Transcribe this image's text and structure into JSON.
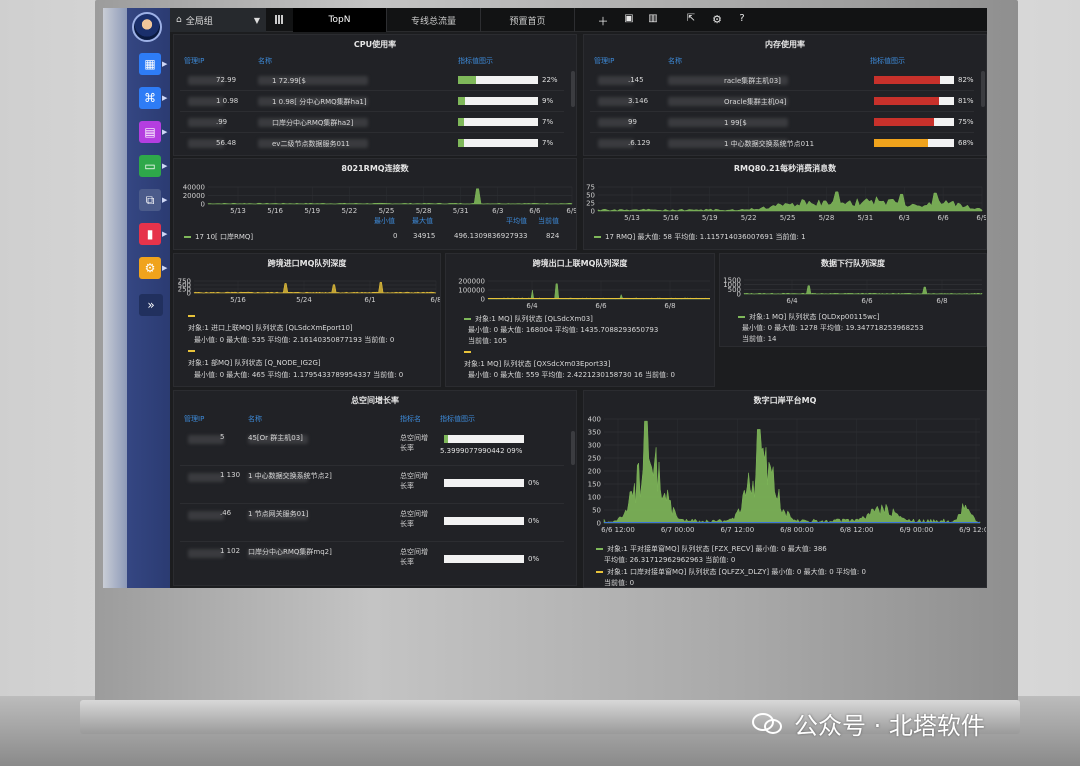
{
  "topbar": {
    "group_select": "全局组",
    "tabs": [
      "TopN",
      "专线总流量",
      "预置首页"
    ],
    "active_tab": 0,
    "icons": [
      "plus-icon",
      "save-icon",
      "trash-icon",
      "external-link-icon",
      "gear-icon",
      "help-icon"
    ]
  },
  "sidebar": {
    "items": [
      "dashboard-icon",
      "topology-icon",
      "app-icon",
      "monitor-icon",
      "devices-icon",
      "report-icon",
      "settings-icon"
    ],
    "colors": [
      "#2e7cf6",
      "#2e7cf6",
      "#b43ee0",
      "#2ea84a",
      "#4b5b8a",
      "#e6334b",
      "#f0a31c"
    ],
    "expand": "»"
  },
  "cpu": {
    "title": "CPU使用率",
    "headers": [
      "管理IP",
      "名称",
      "指标值图示"
    ],
    "rows": [
      {
        "ip": "72.99",
        "name": "1 72.99[$",
        "pct": "22%",
        "value": 22
      },
      {
        "ip": "1 0.98",
        "name": "1 0.98[ 分中心RMQ集群ha1]",
        "pct": "9%",
        "value": 9
      },
      {
        "ip": ".99",
        "name": "口岸分中心RMQ集群ha2]",
        "pct": "7%",
        "value": 7
      },
      {
        "ip": "56.48",
        "name": "ev二级节点数据服务011",
        "pct": "7%",
        "value": 7
      }
    ]
  },
  "mem": {
    "title": "内存使用率",
    "headers": [
      "管理IP",
      "名称",
      "指标值图示"
    ],
    "rows": [
      {
        "ip": ".145",
        "name": "racle集群主机03]",
        "pct": "82%",
        "value": 82,
        "color": "#c8312b"
      },
      {
        "ip": "3.146",
        "name": "Oracle集群主机04]",
        "pct": "81%",
        "value": 81,
        "color": "#c8312b"
      },
      {
        "ip": "99",
        "name": "1 99[$",
        "pct": "75%",
        "value": 75,
        "color": "#c8312b"
      },
      {
        "ip": ".6.129",
        "name": "1 中心数据交换系统节点011",
        "pct": "68%",
        "value": 68,
        "color": "#f0a31c"
      }
    ]
  },
  "rmq8021": {
    "title": "8021RMQ连接数",
    "y_ticks": [
      "40000",
      "20000",
      "0"
    ],
    "x_ticks": [
      "5/13",
      "5/16",
      "5/19",
      "5/22",
      "5/25",
      "5/28",
      "5/31",
      "6/3",
      "6/6",
      "6/9"
    ],
    "stats_headers": [
      "最小值",
      "最大值",
      "平均值",
      "当前值"
    ],
    "legend": "17 10[ 口岸RMQ]",
    "min": "0",
    "max": "34915",
    "avg": "496.1309836927933",
    "cur": "824"
  },
  "rmq8021_msg": {
    "title": "RMQ80.21每秒消费消息数",
    "y_ticks": [
      "75",
      "50",
      "25",
      "0"
    ],
    "x_ticks": [
      "5/13",
      "5/16",
      "5/19",
      "5/22",
      "5/25",
      "5/28",
      "5/31",
      "6/3",
      "6/6",
      "6/9"
    ],
    "legend": "17 RMQ]  最大值: 58  平均值: 1.115714036007691  当前值: 1"
  },
  "q_in": {
    "title": "跨境进口MQ队列深度",
    "y_ticks": [
      "750",
      "500",
      "250",
      "0"
    ],
    "x_ticks": [
      "5/16",
      "5/24",
      "6/1",
      "6/8"
    ],
    "s1_l1": "对象:1 进口上联MQ] 队列状态 [QLSdcXmEport10]",
    "s1_l2": "最小值: 0  最大值: 535  平均值: 2.16140350877193  当前值: 0",
    "s2_l1": "对象:1 部MQ] 队列状态 [Q_NODE_IG2G]",
    "s2_l2": "最小值: 0  最大值: 465  平均值: 1.1795433789954337  当前值: 0"
  },
  "q_out": {
    "title": "跨境出口上联MQ队列深度",
    "y_ticks": [
      "200000",
      "100000",
      "0"
    ],
    "x_ticks": [
      "6/4",
      "6/6",
      "6/8"
    ],
    "s1_l1": "对象:1 MQ] 队列状态 [QLSdcXm03]",
    "s1_l2": "最小值: 0  最大值: 168004  平均值: 1435.7088293650793",
    "s1_l3": "当前值: 105",
    "s2_l1": "对象:1 MQ] 队列状态 [QXSdcXm03Eport33]",
    "s2_l2": "最小值: 0  最大值: 559  平均值: 2.4221230158730 16  当前值: 0"
  },
  "q_down": {
    "title": "数据下行队列深度",
    "y_ticks": [
      "1500",
      "1000",
      "500",
      "0"
    ],
    "x_ticks": [
      "6/4",
      "6/6",
      "6/8"
    ],
    "s1_l1": "对象:1 MQ] 队列状态 [QLDxp00115wc]",
    "s1_l2": "最小值: 0  最大值: 1278  平均值: 19.347718253968253",
    "s1_l3": "当前值: 14"
  },
  "space": {
    "title": "总空间增长率",
    "headers": [
      "管理IP",
      "名称",
      "指标名",
      "指标值图示"
    ],
    "rows": [
      {
        "ip": "5",
        "name": "45[Or 群主机03]",
        "metric": "总空间增长率",
        "pct": "5.3999077990442 09%",
        "value": 5.4
      },
      {
        "ip": "1 130",
        "name": "1 中心数据交换系统节点2]",
        "metric": "总空间增长率",
        "pct": "0%",
        "value": 0
      },
      {
        "ip": ".46",
        "name": "1 节点网关服务01]",
        "metric": "总空间增长率",
        "pct": "0%",
        "value": 0
      },
      {
        "ip": "1 102",
        "name": "口岸分中心RMQ集群mq2]",
        "metric": "总空间增长率",
        "pct": "0%",
        "value": 0
      }
    ]
  },
  "platform": {
    "title": "数字口岸平台MQ",
    "y_ticks": [
      "400",
      "350",
      "300",
      "250",
      "200",
      "150",
      "100",
      "50",
      "0"
    ],
    "x_ticks": [
      "6/6 12:00",
      "6/7 00:00",
      "6/7 12:00",
      "6/8 00:00",
      "6/8 12:00",
      "6/9 00:00",
      "6/9 12:00"
    ],
    "s1_l1": "对象:1 平对接单窗MQ] 队列状态 [FZX_RECV]  最小值: 0  最大值: 386",
    "s1_l2": "平均值: 26.31712962962963  当前值: 0",
    "s2_l1": "对象:1 口岸对接单窗MQ] 队列状态 [QLFZX_DLZY]  最小值: 0  最大值: 0  平均值: 0",
    "s2_l2": "当前值: 0"
  },
  "colors": {
    "green": "#7fb85a",
    "yellow": "#e8c33a",
    "red": "#c8312b",
    "orange": "#f0a31c",
    "header_blue": "#3d8ad8"
  },
  "watermark": "公众号 · 北塔软件"
}
